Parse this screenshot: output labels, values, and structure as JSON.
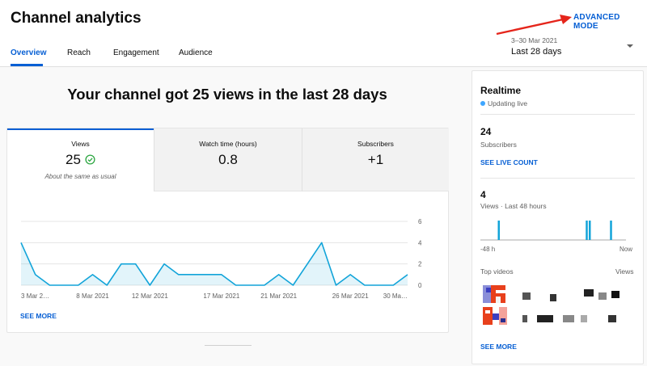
{
  "header": {
    "title": "Channel analytics",
    "advanced_mode": "ADVANCED MODE",
    "tabs": [
      "Overview",
      "Reach",
      "Engagement",
      "Audience"
    ],
    "active_tab": "Overview",
    "date_range": "3–30 Mar 2021",
    "period": "Last 28 days"
  },
  "main": {
    "headline": "Your channel got 25 views in the last 28 days",
    "metrics": [
      {
        "label": "Views",
        "value": "25",
        "note": "About the same as usual"
      },
      {
        "label": "Watch time (hours)",
        "value": "0.8"
      },
      {
        "label": "Subscribers",
        "value": "+1"
      }
    ],
    "see_more": "SEE MORE"
  },
  "chart_data": {
    "type": "area",
    "x": [
      "3 Mar",
      "4 Mar",
      "5 Mar",
      "6 Mar",
      "7 Mar",
      "8 Mar",
      "9 Mar",
      "10 Mar",
      "11 Mar",
      "12 Mar",
      "13 Mar",
      "14 Mar",
      "15 Mar",
      "16 Mar",
      "17 Mar",
      "18 Mar",
      "19 Mar",
      "20 Mar",
      "21 Mar",
      "22 Mar",
      "23 Mar",
      "24 Mar",
      "25 Mar",
      "26 Mar",
      "27 Mar",
      "28 Mar",
      "29 Mar",
      "30 Mar"
    ],
    "values": [
      4,
      1,
      0,
      0,
      0,
      1,
      0,
      2,
      2,
      0,
      2,
      1,
      1,
      1,
      1,
      0,
      0,
      0,
      1,
      0,
      2,
      4,
      0,
      1,
      0,
      0,
      0,
      1
    ],
    "xtick_labels": [
      "3 Mar 2…",
      "8 Mar 2021",
      "12 Mar 2021",
      "17 Mar 2021",
      "21 Mar 2021",
      "26 Mar 2021",
      "30 Ma…"
    ],
    "ylim": [
      0,
      6
    ],
    "yticks": [
      "0",
      "2",
      "4",
      "6"
    ],
    "grid": true,
    "color": "#12a4d9"
  },
  "realtime": {
    "title": "Realtime",
    "status": "Updating live",
    "subscribers_value": "24",
    "subscribers_label": "Subscribers",
    "see_live_count": "SEE LIVE COUNT",
    "views_value": "4",
    "views_label": "Views · Last 48 hours",
    "bars": [
      {
        "hours_ago": 42,
        "views": 1
      },
      {
        "hours_ago": 13,
        "views": 1
      },
      {
        "hours_ago": 12,
        "views": 1
      },
      {
        "hours_ago": 5,
        "views": 1
      }
    ],
    "axis_left": "-48 h",
    "axis_right": "Now",
    "top_videos_label": "Top videos",
    "views_col_label": "Views",
    "see_more": "SEE MORE",
    "bar_color": "#12a4d9"
  },
  "colors": {
    "accent": "#065fd4",
    "annotation_arrow": "#e5251b"
  },
  "icons": [
    "check-circle-icon",
    "dropdown-caret-icon",
    "live-dot-icon",
    "arrow-annotation-icon"
  ]
}
